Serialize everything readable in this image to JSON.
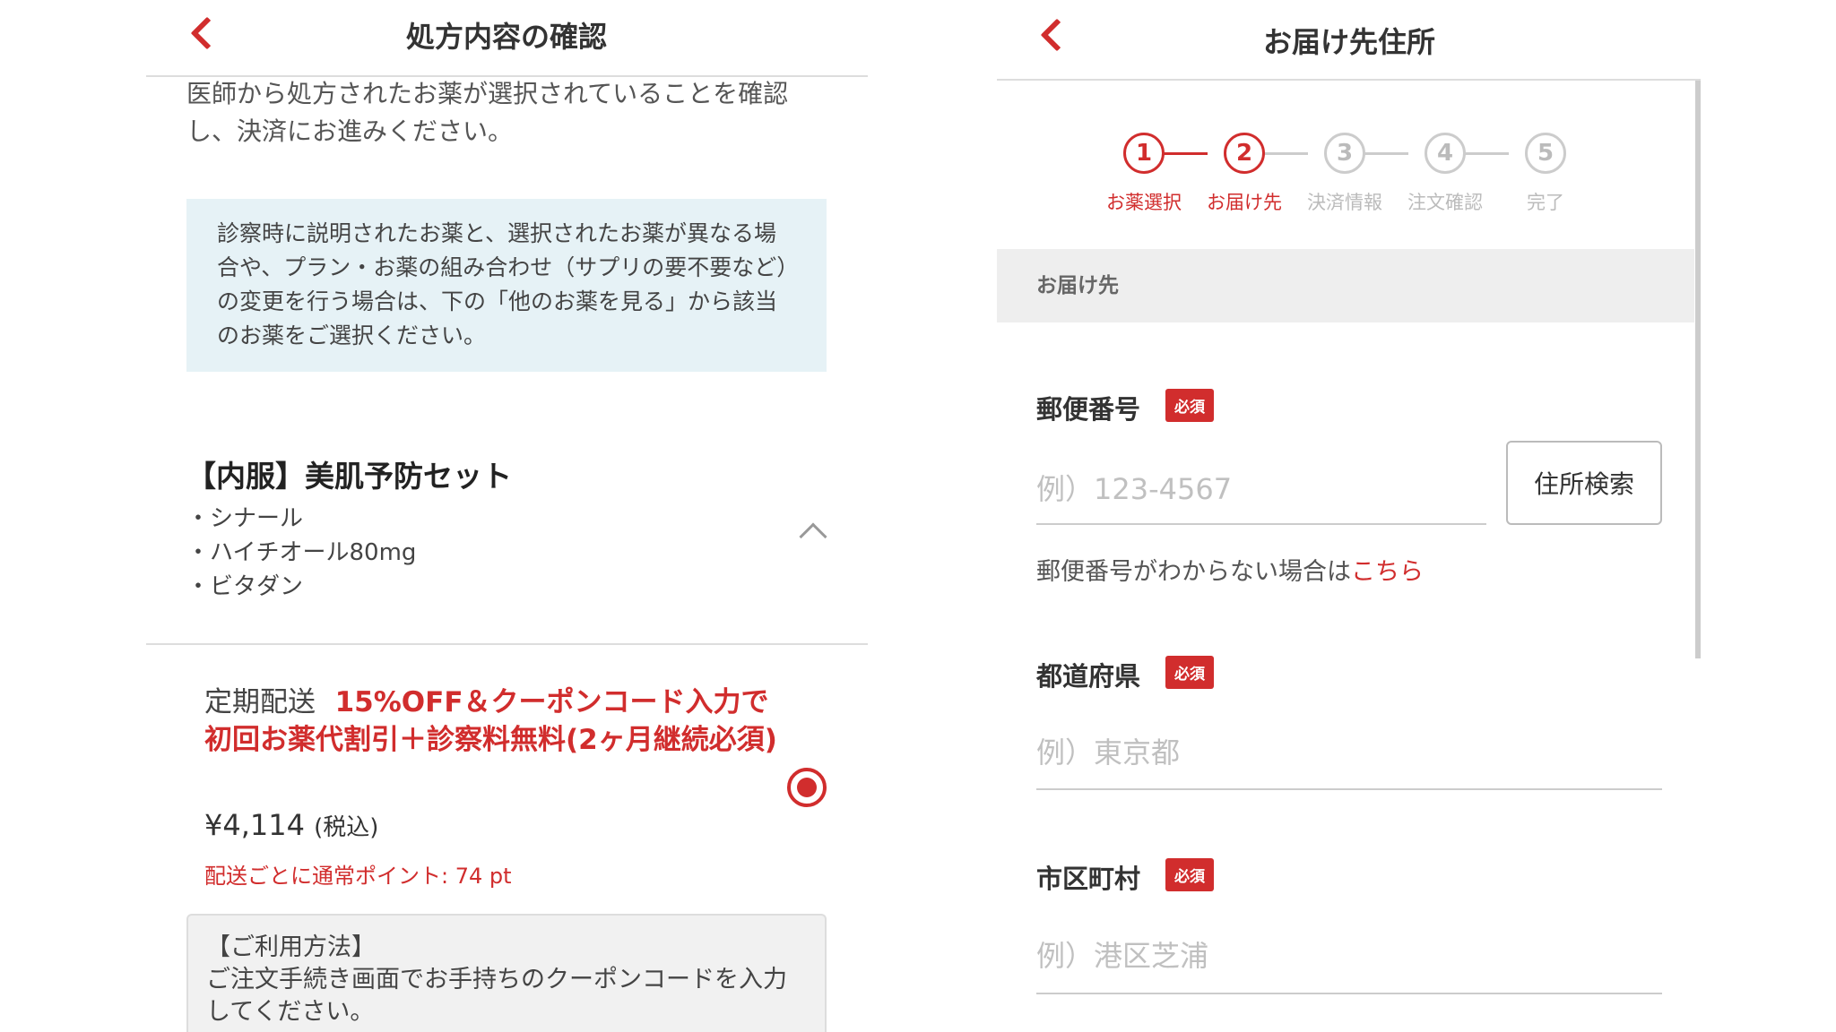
{
  "left": {
    "header": {
      "title": "処方内容の確認"
    },
    "intro": "医師から処方されたお薬が選択されていることを確認し、決済にお進みください。",
    "notice": "診察時に説明されたお薬と、選択されたお薬が異なる場合や、プラン・お薬の組み合わせ（サプリの要不要など）の変更を行う場合は、下の「他のお薬を見る」から該当のお薬をご選択ください。",
    "product": {
      "title": "【内服】美肌予防セット",
      "ingredients": [
        "・シナール",
        "・ハイチオール80mg",
        "・ビタダン"
      ]
    },
    "plan": {
      "lead": "定期配送",
      "promo": "15%OFF＆クーポンコード入力で初回お薬代割引＋診察料無料(2ヶ月継続必須)",
      "price": "¥4,114",
      "tax": "(税込)",
      "points": "配送ごとに通常ポイント: 74 pt",
      "selected": true
    },
    "usage": {
      "title": "【ご利用方法】",
      "text": "ご注文手続き画面でお手持ちのクーポンコードを入力してください。"
    }
  },
  "right": {
    "header": {
      "title": "お届け先住所"
    },
    "steps": [
      {
        "num": "1",
        "label": "お薬選択",
        "active": true
      },
      {
        "num": "2",
        "label": "お届け先",
        "active": true
      },
      {
        "num": "3",
        "label": "決済情報",
        "active": false
      },
      {
        "num": "4",
        "label": "注文確認",
        "active": false
      },
      {
        "num": "5",
        "label": "完了",
        "active": false
      }
    ],
    "section_title": "お届け先",
    "required_badge": "必須",
    "postal": {
      "label": "郵便番号",
      "placeholder": "例）123-4567",
      "button": "住所検索",
      "help": "郵便番号がわからない場合は",
      "help_link": "こちら"
    },
    "prefecture": {
      "label": "都道府県",
      "placeholder": "例）東京都"
    },
    "city": {
      "label": "市区町村",
      "placeholder": "例）港区芝浦"
    }
  },
  "colors": {
    "accent": "#d12d2d",
    "notice_bg": "#e6f2f6",
    "section_bg": "#eeeeee"
  }
}
